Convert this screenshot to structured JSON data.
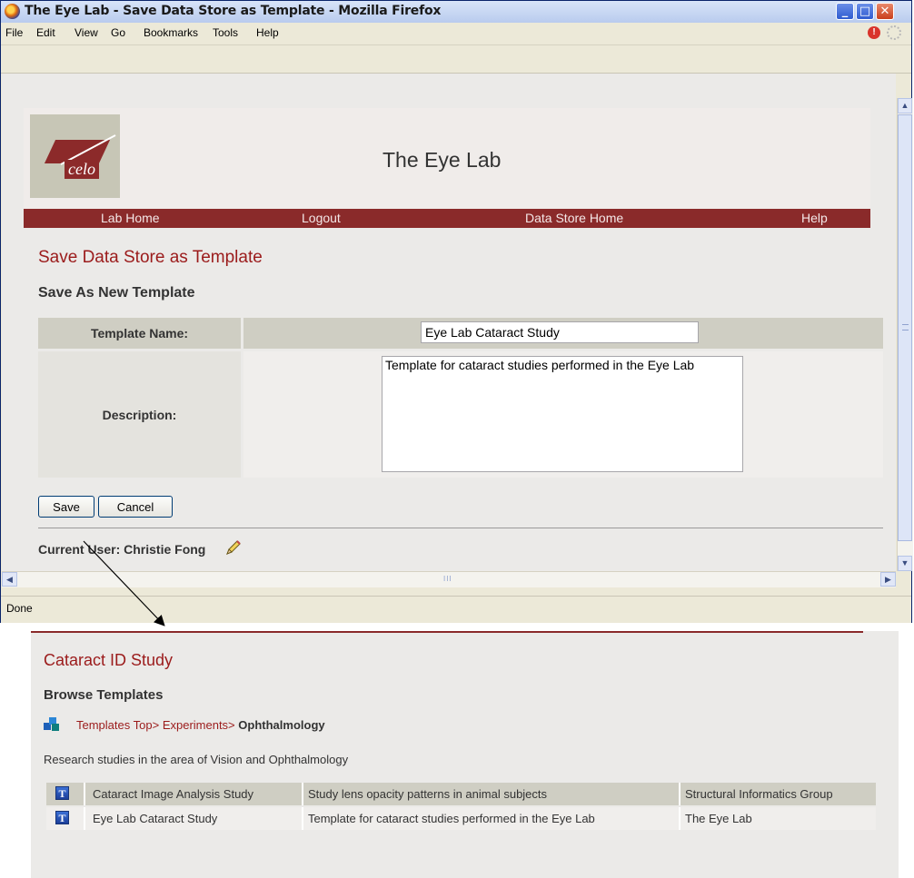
{
  "window": {
    "title": "The Eye Lab - Save Data Store as Template - Mozilla Firefox",
    "status": "Done"
  },
  "menubar": [
    "File",
    "Edit",
    "View",
    "Go",
    "Bookmarks",
    "Tools",
    "Help"
  ],
  "site": {
    "logo_text": "celo",
    "title": "The Eye Lab",
    "nav": [
      "Lab Home",
      "Logout",
      "Data Store Home",
      "Help"
    ]
  },
  "page": {
    "heading": "Save Data Store as Template",
    "subheading": "Save As New Template",
    "form": {
      "name_label": "Template Name:",
      "name_value": "Eye Lab Cataract Study",
      "description_label": "Description:",
      "description_value": "Template for cataract studies performed in the Eye Lab"
    },
    "save_label": "Save",
    "cancel_label": "Cancel",
    "current_user": "Current User: Christie Fong"
  },
  "browse": {
    "title": "Cataract ID Study",
    "subtitle": "Browse Templates",
    "breadcrumb": [
      {
        "label": "Templates Top>",
        "link": true
      },
      {
        "label": "Experiments>",
        "link": true
      },
      {
        "label": "Ophthalmology",
        "link": false
      }
    ],
    "description": "Research studies in the area of Vision and Ophthalmology",
    "rows": [
      {
        "name": "Cataract Image Analysis Study",
        "description": "Study lens opacity patterns in animal subjects",
        "owner": "Structural Informatics Group"
      },
      {
        "name": "Eye Lab Cataract Study",
        "description": "Template for cataract studies performed in the Eye Lab",
        "owner": "The Eye Lab"
      }
    ]
  },
  "colors": {
    "accent": "#9b1b1b",
    "navbar": "#8a2a2a",
    "row_dark": "#cfcec3",
    "row_light": "#f0eeec"
  }
}
